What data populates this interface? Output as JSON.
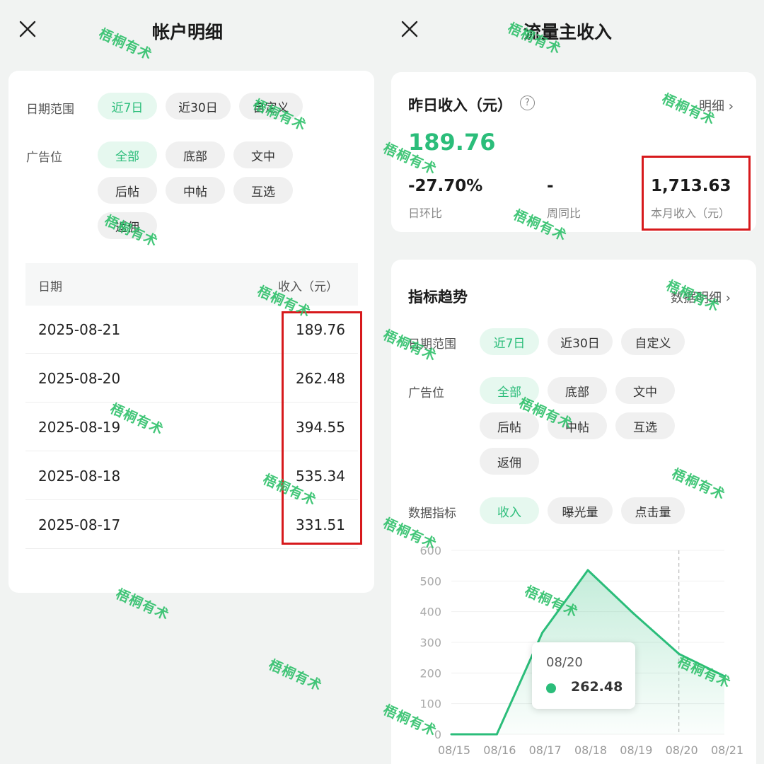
{
  "left": {
    "title": "帐户明细",
    "filters": {
      "date_label": "日期范围",
      "date_options": [
        "近7日",
        "近30日",
        "自定义"
      ],
      "ad_label": "广告位",
      "ad_options": [
        "全部",
        "底部",
        "文中",
        "后帖",
        "中帖",
        "互选",
        "返佣"
      ]
    },
    "table": {
      "columns": [
        "日期",
        "收入（元）"
      ],
      "rows": [
        {
          "date": "2025-08-21",
          "value": "189.76"
        },
        {
          "date": "2025-08-20",
          "value": "262.48"
        },
        {
          "date": "2025-08-19",
          "value": "394.55"
        },
        {
          "date": "2025-08-18",
          "value": "535.34"
        },
        {
          "date": "2025-08-17",
          "value": "331.51"
        }
      ]
    }
  },
  "right": {
    "title": "流量主收入",
    "summary": {
      "heading": "昨日收入（元）",
      "detail_link": "明细",
      "amount": "189.76",
      "stats": [
        {
          "value": "-27.70%",
          "label": "日环比"
        },
        {
          "value": "-",
          "label": "周同比"
        },
        {
          "value": "1,713.63",
          "label": "本月收入（元）"
        }
      ]
    },
    "trend": {
      "heading": "指标趋势",
      "detail_link": "数据明细",
      "date_label": "日期范围",
      "date_options": [
        "近7日",
        "近30日",
        "自定义"
      ],
      "ad_label": "广告位",
      "ad_options": [
        "全部",
        "底部",
        "文中",
        "后帖",
        "中帖",
        "互选",
        "返佣"
      ],
      "metric_label": "数据指标",
      "metric_options": [
        "收入",
        "曝光量",
        "点击量"
      ],
      "tooltip": {
        "date": "08/20",
        "value": "262.48"
      }
    }
  },
  "watermark_text": "梧桐有术",
  "colors": {
    "accent": "#2bbd7a",
    "highlight_box": "#d7191c"
  },
  "chart_data": {
    "type": "area",
    "categories": [
      "08/15",
      "08/16",
      "08/17",
      "08/18",
      "08/19",
      "08/20",
      "08/21"
    ],
    "values": [
      0,
      0,
      331.51,
      535.34,
      394.55,
      262.48,
      189.76
    ],
    "ylim": [
      0,
      600
    ],
    "yticks": [
      0,
      100,
      200,
      300,
      400,
      500,
      600
    ],
    "highlight_category": "08/20"
  }
}
